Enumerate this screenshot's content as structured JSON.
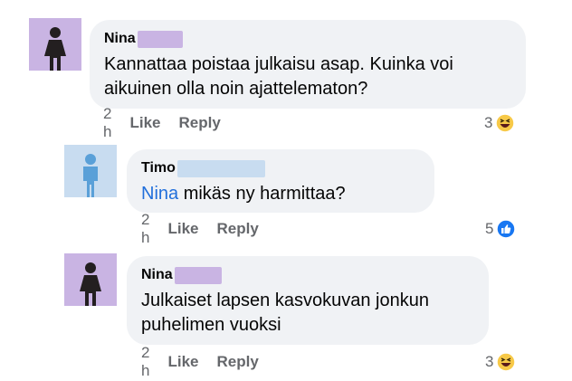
{
  "colors": {
    "female_avatar_bg": "#c9b4e3",
    "female_avatar_figure": "#231f20",
    "male_avatar_bg": "#c8dcf0",
    "male_avatar_figure": "#5aa0d8",
    "bubble_bg": "#f0f2f5",
    "mention": "#216fdb",
    "redact_purple": "#c9b4e3",
    "redact_blue": "#c8dcf0",
    "like_blue": "#1877f2",
    "haha_yellow": "#f7c948"
  },
  "comments": [
    {
      "avatar_icon": "female-user-icon",
      "author": "Nina",
      "text": "Kannattaa poistaa julkaisu asap. Kuinka voi aikuinen olla noin ajattelematon?",
      "time": "2 h",
      "like_label": "Like",
      "reply_label": "Reply",
      "reaction_count": "3",
      "reaction_icon": "haha-reaction-icon"
    },
    {
      "avatar_icon": "male-user-icon",
      "author": "Timo",
      "mention": "Nina",
      "text": " mikäs ny harmittaa?",
      "time": "2 h",
      "like_label": "Like",
      "reply_label": "Reply",
      "reaction_count": "5",
      "reaction_icon": "like-reaction-icon"
    },
    {
      "avatar_icon": "female-user-icon",
      "author": "Nina",
      "text": "Julkaiset lapsen kasvokuvan jonkun puhelimen vuoksi",
      "time": "2 h",
      "like_label": "Like",
      "reply_label": "Reply",
      "reaction_count": "3",
      "reaction_icon": "haha-reaction-icon"
    }
  ]
}
